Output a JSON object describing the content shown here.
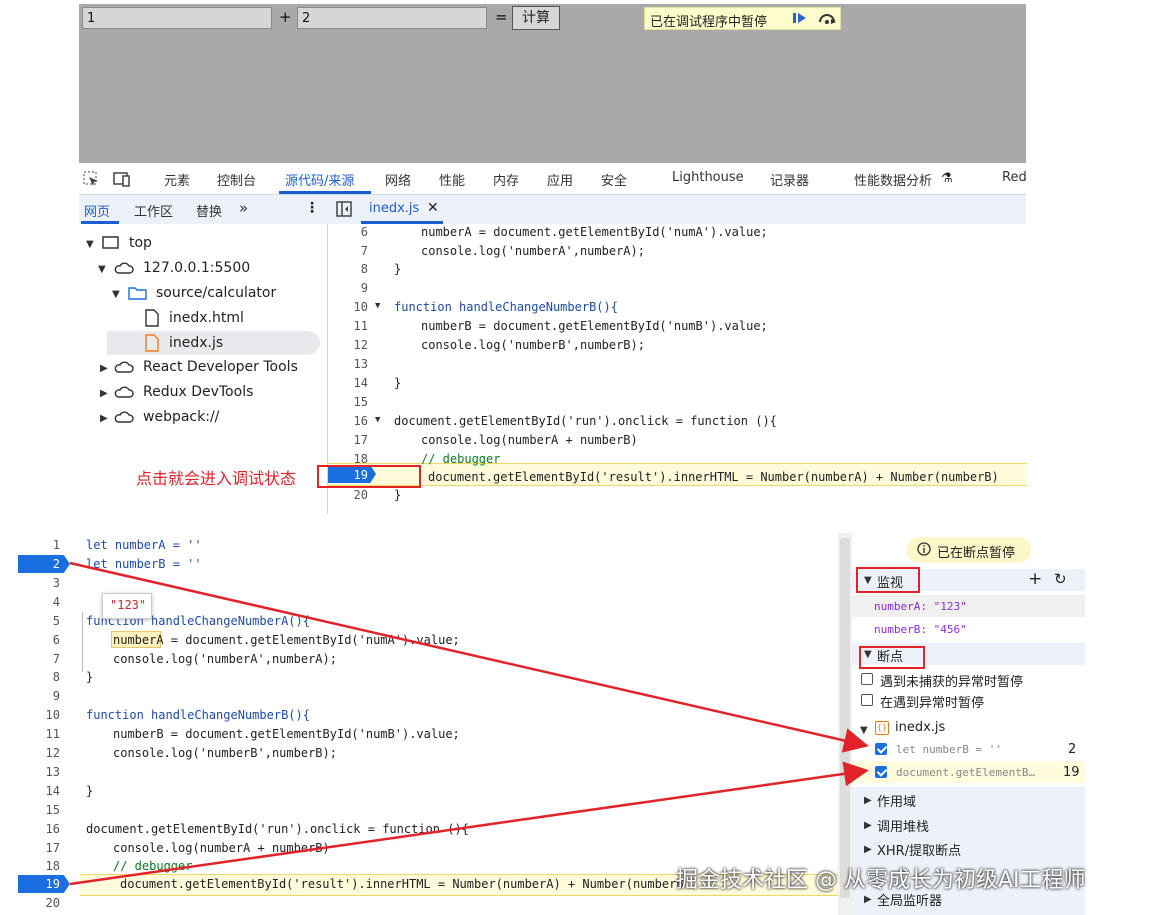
{
  "browser": {
    "input_a": "1",
    "plus": "+",
    "input_b": "2",
    "equals": "=",
    "calc_button": "计算",
    "paused_text": "已在调试程序中暂停"
  },
  "devtools_tabs": [
    "元素",
    "控制台",
    "源代码/来源",
    "网络",
    "性能",
    "内存",
    "应用",
    "安全",
    "Lighthouse",
    "记录器",
    "性能数据分析",
    "Red"
  ],
  "sub_tabs": [
    "网页",
    "工作区",
    "替换",
    "»"
  ],
  "open_file_tab": "inedx.js",
  "tree": {
    "top": "top",
    "host": "127.0.0.1:5500",
    "folder": "source/calculator",
    "file_html": "inedx.html",
    "file_js": "inedx.js",
    "react": "React Developer Tools",
    "redux": "Redux DevTools",
    "webpack": "webpack://"
  },
  "top_code": {
    "line_numbers": [
      "6",
      "7",
      "8",
      "9",
      "10",
      "11",
      "12",
      "13",
      "14",
      "15",
      "16",
      "17",
      "18",
      "19",
      "20"
    ],
    "l6": "numberA = document.getElementById('numA').value;",
    "l7": "console.log('numberA',numberA);",
    "l8": "}",
    "l10": "function handleChangeNumberB(){",
    "l11": "numberB = document.getElementById('numB').value;",
    "l12": "console.log('numberB',numberB);",
    "l14": "}",
    "l16": "document.getElementById('run').onclick = function (){",
    "l17": "console.log(numberA + numberB)",
    "l18": "// debugger",
    "l19": "document.getElementById('result').innerHTML = Number(numberA) + Number(numberB)",
    "l20": "}"
  },
  "annotation_text": "点击就会进入调试状态",
  "bottom_code": {
    "line_numbers": [
      "1",
      "2",
      "3",
      "4",
      "5",
      "6",
      "7",
      "8",
      "9",
      "10",
      "11",
      "12",
      "13",
      "14",
      "15",
      "16",
      "17",
      "18",
      "19",
      "20"
    ],
    "l1": "let numberA = ''",
    "l2": "let numberB = ''",
    "tooltip": "\"123\"",
    "l5": "function handleChangeNumberA(){",
    "l6": "numberA = document.getElementById('numA').value;",
    "l7": "console.log('numberA',numberA);",
    "l8": "}",
    "l10": "function handleChangeNumberB(){",
    "l11": "numberB = document.getElementById('numB').value;",
    "l12": "console.log('numberB',numberB);",
    "l14": "}",
    "l16": "document.getElementById('run').onclick = function (){",
    "l17": "console.log(numberA + numberB)",
    "l18": "// debugger",
    "l19": "document.getElementById('result').innerHTML = Number(numberA) + Number(numberB"
  },
  "right_panel": {
    "paused_badge": "已在断点暂停",
    "watch_title": "监视",
    "watch_a": "numberA: \"123\"",
    "watch_b": "numberB: \"456\"",
    "breakpoints_title": "断点",
    "pause_uncaught": "遇到未捕获的异常时暂停",
    "pause_caught": "在遇到异常时暂停",
    "file": "inedx.js",
    "bp1_code": "let numberB = ''",
    "bp1_line": "2",
    "bp2_code": "document.getElementB…",
    "bp2_line": "19",
    "scope": "作用域",
    "callstack": "调用堆栈",
    "xhr": "XHR/提取断点",
    "global": "全局监听器"
  },
  "watermark": "掘金技术社区 @ 从零成长为初级AI工程师"
}
